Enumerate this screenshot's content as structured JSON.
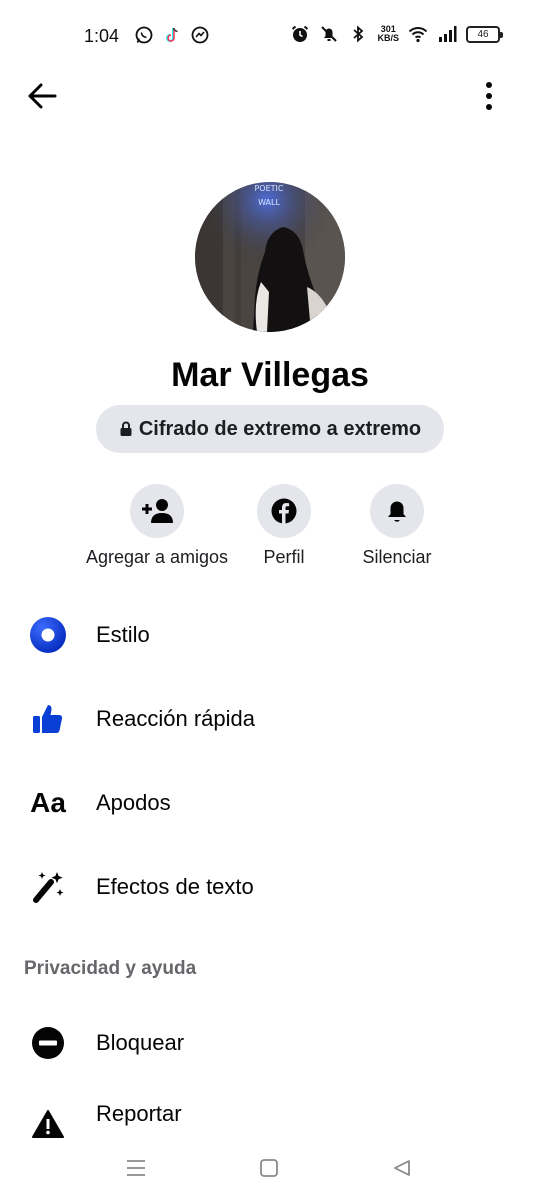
{
  "status_bar": {
    "time": "1:04",
    "net_speed_value": "301",
    "net_speed_unit": "KB/S",
    "battery": "46",
    "icons": [
      "whatsapp-icon",
      "tiktok-icon",
      "messenger-icon",
      "alarm-icon",
      "mute-icon",
      "bluetooth-icon",
      "wifi-icon",
      "signal-icon"
    ]
  },
  "header": {
    "back_icon": "arrow-left-icon",
    "more_icon": "more-vertical-icon"
  },
  "profile": {
    "avatar_sign_line1": "POETIC",
    "avatar_sign_line2": "WALL",
    "name": "Mar Villegas",
    "encryption_label": "Cifrado de extremo a extremo"
  },
  "actions": [
    {
      "label": "Agregar a amigos",
      "icon": "add-friend-icon"
    },
    {
      "label": "Perfil",
      "icon": "facebook-icon"
    },
    {
      "label": "Silenciar",
      "icon": "bell-icon"
    }
  ],
  "menu": [
    {
      "label": "Estilo",
      "icon": "theme-icon"
    },
    {
      "label": "Reacción rápida",
      "icon": "thumbs-up-icon"
    },
    {
      "label": "Apodos",
      "icon": "aa-text-icon",
      "icon_text": "Aa"
    },
    {
      "label": "Efectos de texto",
      "icon": "magic-wand-icon"
    }
  ],
  "privacy": {
    "header": "Privacidad y ayuda",
    "items": [
      {
        "label": "Bloquear",
        "icon": "block-icon"
      },
      {
        "label": "Reportar",
        "icon": "warning-icon"
      }
    ]
  },
  "nav": {
    "icons": [
      "menu-nav-icon",
      "home-nav-icon",
      "back-nav-icon"
    ]
  },
  "colors": {
    "accent": "#0a3fd6",
    "pill_bg": "#e4e6eb",
    "secondary_text": "#65676b"
  }
}
